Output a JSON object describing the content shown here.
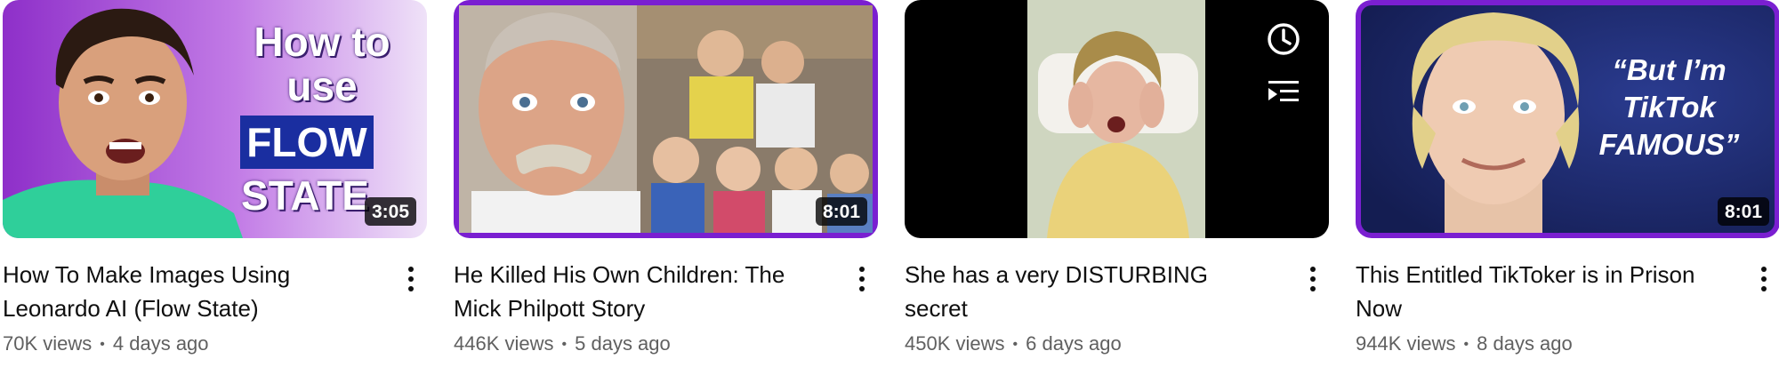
{
  "videos": [
    {
      "title": "How To Make Images Using Leonardo AI (Flow State)",
      "views": "70K views",
      "age": "4 days ago",
      "duration": "3:05",
      "thumb_text": [
        "How to use",
        "FLOW",
        "STATE"
      ],
      "thumb_colors": {
        "bg": "#a44fd6",
        "accent": "#1a2ea0"
      }
    },
    {
      "title": "He Killed His Own Children: The Mick Philpott Story",
      "views": "446K views",
      "age": "5 days ago",
      "duration": "8:01",
      "thumb_colors": {
        "border": "#7a1fd1"
      }
    },
    {
      "title": "She has a very DISTURBING secret",
      "views": "450K views",
      "age": "6 days ago",
      "hover_icons": [
        "clock-icon",
        "add-to-queue-icon"
      ],
      "thumb_colors": {
        "bg": "#000000"
      }
    },
    {
      "title": "This Entitled TikToker is in Prison Now",
      "views": "944K views",
      "age": "8 days ago",
      "duration": "8:01",
      "thumb_text": [
        "“But I’m TikTok FAMOUS”"
      ],
      "thumb_colors": {
        "border": "#7a1fd1",
        "bg": "#1e2b6e"
      }
    }
  ],
  "meta_separator": "•"
}
